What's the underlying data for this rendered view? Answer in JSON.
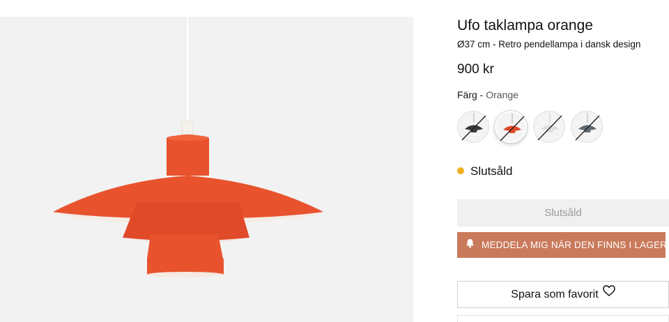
{
  "product": {
    "title": "Ufo taklampa orange",
    "subtitle": "Ø37 cm - Retro pendellampa i dansk design",
    "price": "900 kr",
    "color_label": "Färg - ",
    "color_value": "Orange"
  },
  "swatches": [
    {
      "name": "swatch-black",
      "lamp_color": "#3a3a3a",
      "selected": false
    },
    {
      "name": "swatch-orange",
      "lamp_color": "#e04a28",
      "selected": true
    },
    {
      "name": "swatch-white",
      "lamp_color": "#e8e8e8",
      "selected": false
    },
    {
      "name": "swatch-grey",
      "lamp_color": "#5f6b75",
      "selected": false
    }
  ],
  "stock": {
    "status": "Slutsåld",
    "dot_color": "#f2b01e"
  },
  "buttons": {
    "soldout_label": "Slutsåld",
    "notify_label": "MEDDELA MIG NÄR DEN FINNS I LAGER",
    "favorite_label": "Spara som favorit"
  },
  "icons": {
    "notify": "bell-icon",
    "favorite": "heart-icon"
  },
  "colors": {
    "lamp": "#e8532e",
    "notify_button": "#c97a5b",
    "image_bg": "#f2f2f2"
  }
}
